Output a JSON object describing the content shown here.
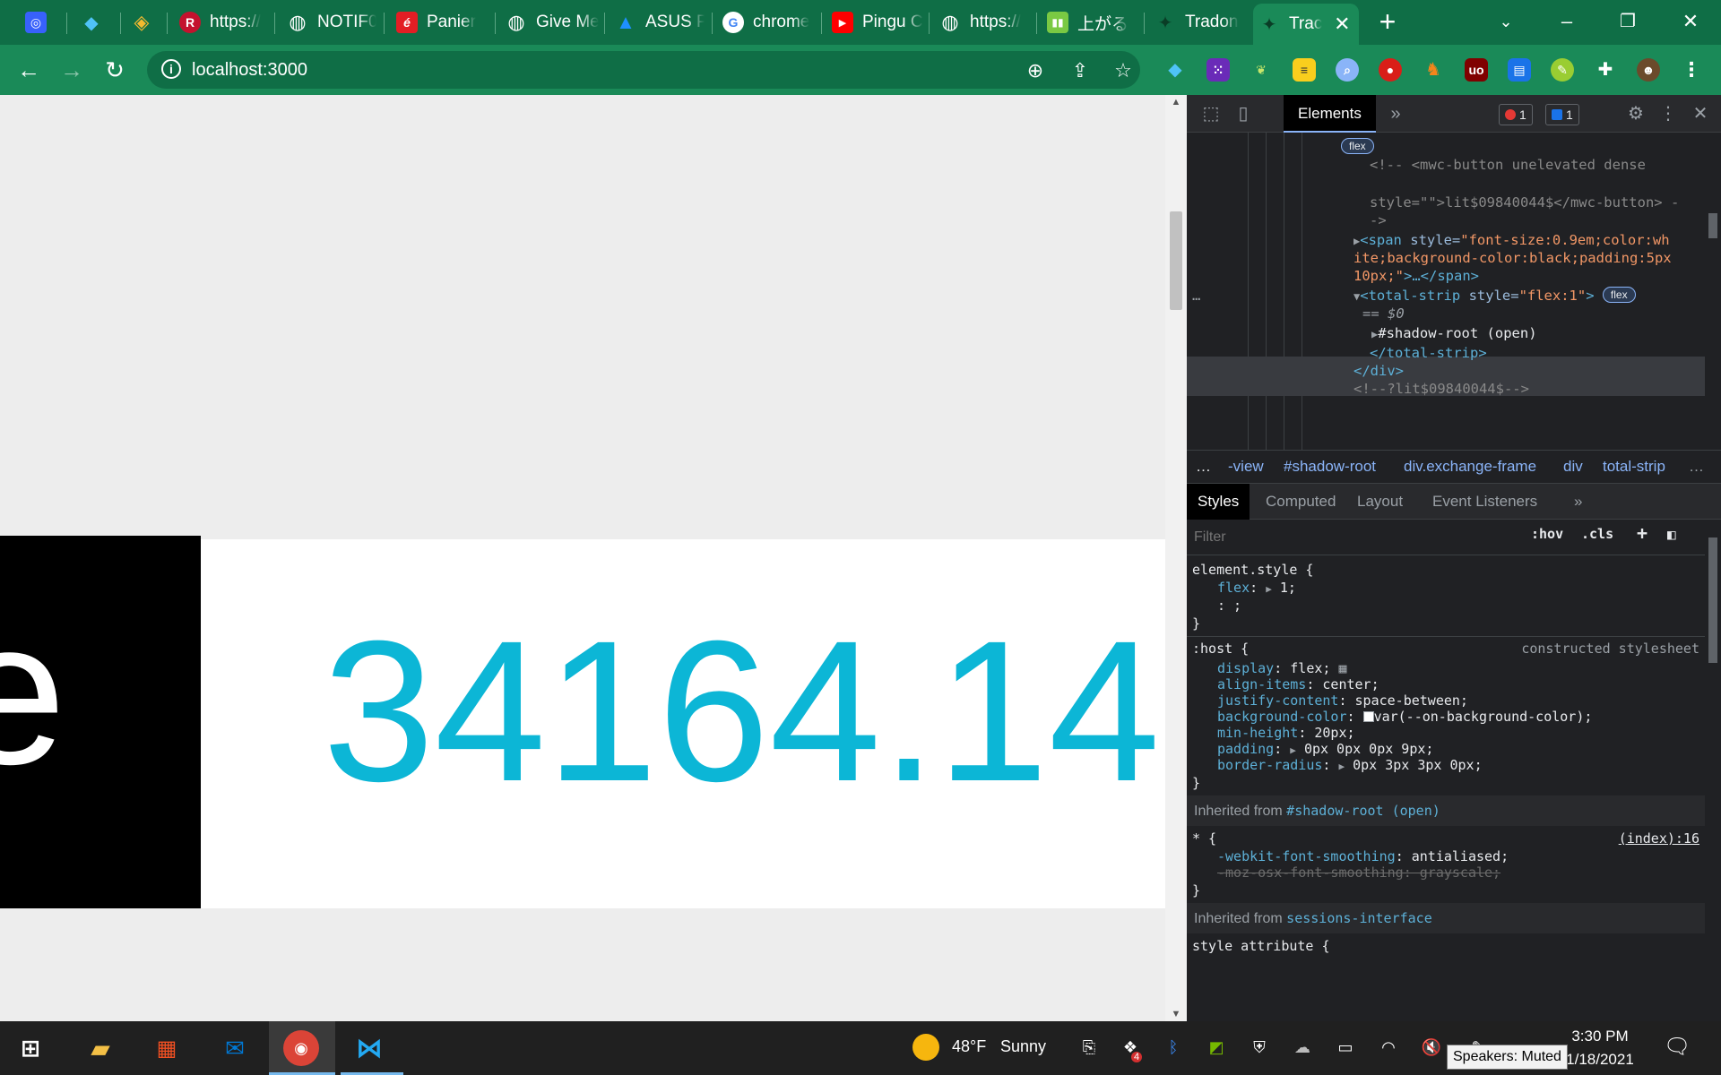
{
  "browser": {
    "tabs": [
      {
        "title": "",
        "icon": "coinmarketcap-icon"
      },
      {
        "title": "",
        "icon": "gem-icon"
      },
      {
        "title": "",
        "icon": "binance-icon"
      },
      {
        "title": "https://",
        "icon": "r-icon"
      },
      {
        "title": "NOTIF0",
        "icon": "globe-icon"
      },
      {
        "title": "Panier",
        "icon": "e-icon"
      },
      {
        "title": "Give Me",
        "icon": "globe-icon"
      },
      {
        "title": "ASUS P",
        "icon": "asus-icon"
      },
      {
        "title": "chrome",
        "icon": "google-icon"
      },
      {
        "title": "Pingu C",
        "icon": "youtube-icon"
      },
      {
        "title": "https://",
        "icon": "globe-icon"
      },
      {
        "title": "上がる",
        "icon": "book-icon"
      },
      {
        "title": "Tradon",
        "icon": "tradon-icon"
      },
      {
        "title": "Trac",
        "icon": "tradon-icon",
        "active": true
      }
    ],
    "address": "localhost:3000",
    "accent": "#0f6e46"
  },
  "page": {
    "label_fragment": "e",
    "total_value": "34164.14"
  },
  "devtools": {
    "main_tab": "Elements",
    "error_count": "1",
    "message_count": "1",
    "dom_lines": {
      "flex_pill_1": "flex",
      "comment_open": "<!-- <mwc-button unelevated dense",
      "comment_style": "style=\"\">lit$09840044$</mwc-button> -",
      "comment_close": "->",
      "span_open": "<span",
      "span_attr": "style=",
      "span_val_1": "\"font-size:0.9em;color:wh",
      "span_val_2": "ite;background-color:black;padding:5px",
      "span_val_3": "10px;\"",
      "span_close": ">…</span>",
      "ts_open": "<total-strip",
      "ts_attr": "style=",
      "ts_val": "\"flex:1\"",
      "ts_gt": ">",
      "flex_pill_2": "flex",
      "eq_dollar": "== $0",
      "shadow_root": "#shadow-root (open)",
      "ts_end": "</total-strip>",
      "div_end": "</div>",
      "lit_comment": "<!--?lit$09840044$-->",
      "ellipsis": "…"
    },
    "breadcrumbs": [
      "-view",
      "#shadow-root",
      "div.exchange-frame",
      "div",
      "total-strip"
    ],
    "subtabs": [
      "Styles",
      "Computed",
      "Layout",
      "Event Listeners"
    ],
    "filter_placeholder": "Filter",
    "hov": ":hov",
    "cls": ".cls",
    "styles": {
      "element_style_sel": "element.style {",
      "flex_prop": "flex",
      "flex_val": "1;",
      "empty_prop": ": ;",
      "close": "}",
      "host_sel": ":host {",
      "host_src": "constructed stylesheet",
      "host_props": [
        {
          "p": "display",
          "v": "flex;"
        },
        {
          "p": "align-items",
          "v": "center;"
        },
        {
          "p": "justify-content",
          "v": "space-between;"
        },
        {
          "p": "background-color",
          "v": "var(--on-background-color);"
        },
        {
          "p": "min-height",
          "v": "20px;"
        },
        {
          "p": "padding",
          "v": "0px 0px 0px 9px;"
        },
        {
          "p": "border-radius",
          "v": "0px 3px 3px 0px;"
        }
      ],
      "inherited_from_1_label": "Inherited from",
      "inherited_from_1_link": "#shadow-root (open)",
      "star_sel": "* {",
      "star_src": "(index):16",
      "smoothing_prop": "-webkit-font-smoothing",
      "smoothing_val": "antialiased;",
      "moz_line": "-moz-osx-font-smoothing: grayscale;",
      "inherited_from_2_label": "Inherited from",
      "inherited_from_2_link": "sessions-interface",
      "style_attr_sel": "style attribute {"
    }
  },
  "taskbar": {
    "weather_temp": "48°F",
    "weather_text": "Sunny",
    "time": "3:30 PM",
    "date": "1/18/2021",
    "tooltip": "Speakers: Muted",
    "notification_count": "4"
  }
}
